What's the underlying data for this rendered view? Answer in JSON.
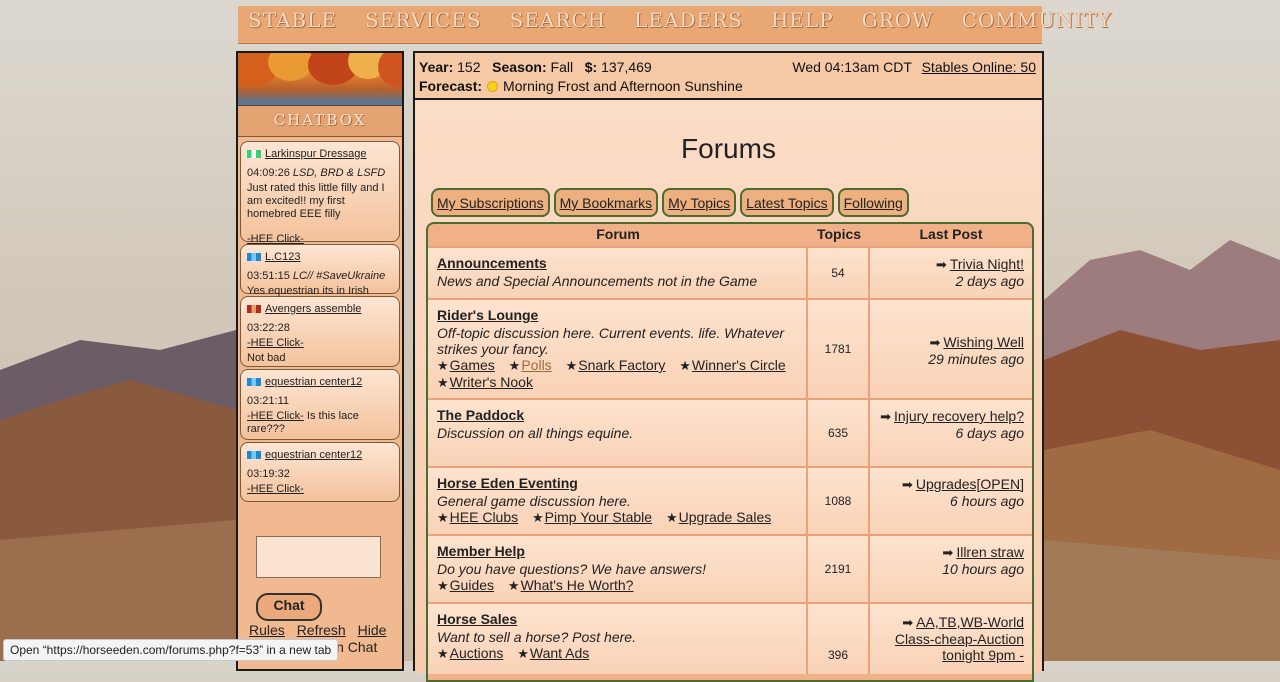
{
  "nav": {
    "items": [
      "STABLE",
      "SERVICES",
      "SEARCH",
      "LEADERS",
      "HELP",
      "GROW",
      "COMMUNITY"
    ]
  },
  "chatbox": {
    "title": "CHATBOX",
    "messages": [
      {
        "user": "Larkinspur Dressage",
        "flag": [
          "#33d07a",
          "#ffffff",
          "#33d07a"
        ],
        "time": "04:09:26",
        "tag": "LSD, BRD & LSFD",
        "lines": [
          "Just rated this little filly and I am excited!! my first homebred EEE filly"
        ],
        "link": "-HEE Click-",
        "after": ""
      },
      {
        "user": "L.C123",
        "flag": [
          "#1e88d0",
          "#79c7ff",
          "#1e88d0"
        ],
        "time": "03:51:15",
        "tag": "LC// #SaveUkraine",
        "lines": [
          "Yes equestrian its in Irish"
        ],
        "link": "",
        "after": ""
      },
      {
        "user": "Avengers assemble",
        "flag": [
          "#b52a1a",
          "#e0a070",
          "#b52a1a"
        ],
        "time": "03:22:28",
        "tag": "",
        "lines": [],
        "link": "-HEE Click-",
        "after": "Not bad"
      },
      {
        "user": "equestrian center12",
        "flag": [
          "#1e88d0",
          "#79c7ff",
          "#1e88d0"
        ],
        "time": "03:21:11",
        "tag": "",
        "lines": [],
        "link": "-HEE Click-",
        "after": " Is this lace rare???"
      },
      {
        "user": "equestrian center12",
        "flag": [
          "#1e88d0",
          "#79c7ff",
          "#1e88d0"
        ],
        "time": "03:19:32",
        "tag": "",
        "lines": [],
        "link": "-HEE Click-",
        "after": ""
      }
    ],
    "chat_button": "Chat",
    "links": [
      "Rules",
      "Refresh",
      "Hide"
    ],
    "partial_text": "in Chat"
  },
  "info": {
    "year_label": "Year:",
    "year": "152",
    "season_label": "Season:",
    "season": "Fall",
    "money_label": "$:",
    "money": "137,469",
    "forecast_label": "Forecast:",
    "forecast": "Morning Frost and Afternoon Sunshine",
    "datetime": "Wed 04:13am CDT",
    "stables_online": "Stables Online: 50"
  },
  "page_title": "Forums",
  "tabs": [
    "My Subscriptions",
    "My Bookmarks",
    "My Topics",
    "Latest Topics",
    "Following"
  ],
  "table": {
    "headers": [
      "Forum",
      "Topics",
      "Last Post"
    ],
    "rows": [
      {
        "name": "Announcements",
        "desc": "News and Special Announcements not in the Game",
        "subs": [],
        "topics": "54",
        "last_title": "Trivia Night!",
        "last_ago": "2 days ago"
      },
      {
        "name": "Rider's Lounge",
        "desc": "Off-topic discussion here. Current events. life. Whatever strikes your fancy.",
        "subs": [
          "Games",
          "Polls",
          "Snark Factory",
          "Winner's Circle",
          "Writer's Nook"
        ],
        "topics": "1781",
        "last_title": "Wishing Well",
        "last_ago": "29 minutes ago"
      },
      {
        "name": "The Paddock",
        "desc": "Discussion on all things equine.",
        "subs": [],
        "topics": "635",
        "last_title": "Injury recovery help?",
        "last_ago": "6 days ago"
      },
      {
        "name": "Horse Eden Eventing",
        "desc": "General game discussion here.",
        "subs": [
          "HEE Clubs",
          "Pimp Your Stable",
          "Upgrade Sales"
        ],
        "topics": "1088",
        "last_title": "Upgrades[OPEN]",
        "last_ago": "6 hours ago"
      },
      {
        "name": "Member Help",
        "desc": "Do you have questions? We have answers!",
        "subs": [
          "Guides",
          "What's He Worth?"
        ],
        "topics": "2191",
        "last_title": "Illren straw",
        "last_ago": "10 hours ago"
      },
      {
        "name": "Horse Sales",
        "desc": "Want to sell a horse? Post here.",
        "subs": [
          "Auctions",
          "Want Ads"
        ],
        "topics": "396",
        "last_title": "AA,TB,WB-World Class-cheap-Auction tonight 9pm -",
        "last_ago": ""
      }
    ]
  },
  "statusbar": "Open “https://horseeden.com/forums.php?f=53” in a new tab"
}
